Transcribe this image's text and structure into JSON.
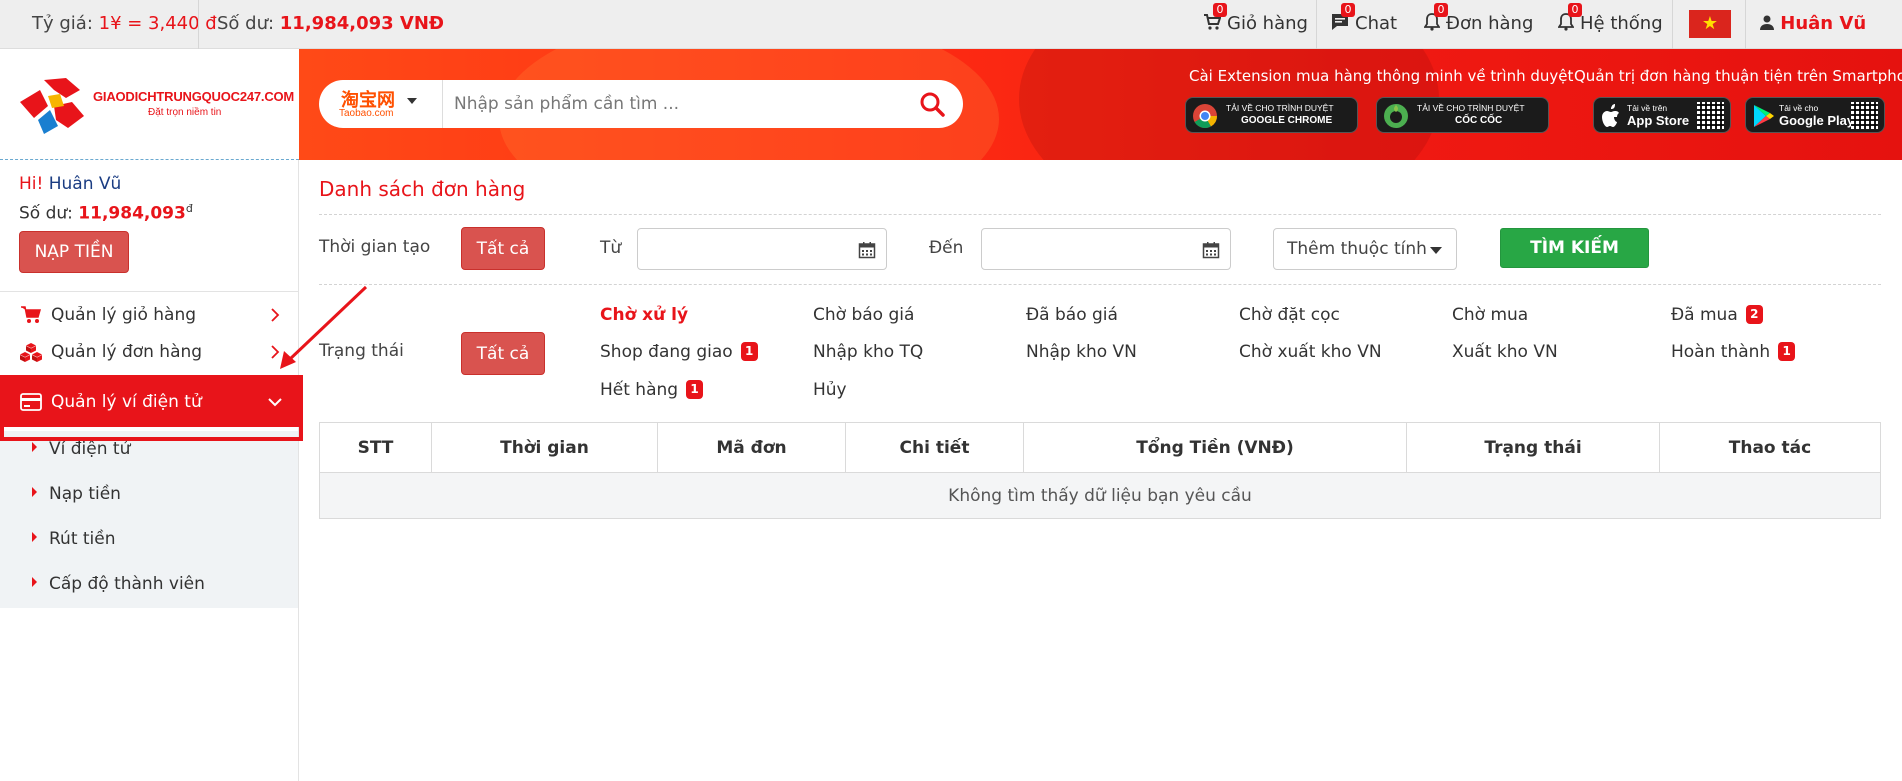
{
  "topbar": {
    "rate_label": "Tỷ giá: ",
    "rate_value": "1¥ = 3,440 đ",
    "balance_label": "Số dư: ",
    "balance_value": "11,984,093 VNĐ",
    "nav": [
      {
        "label": "Giỏ hàng",
        "badge": "0",
        "icon": "cart-icon"
      },
      {
        "label": "Chat",
        "badge": "0",
        "icon": "chat-icon"
      },
      {
        "label": "Đơn hàng",
        "badge": "0",
        "icon": "bell-icon"
      },
      {
        "label": "Hệ thống",
        "badge": "0",
        "icon": "bell-icon"
      }
    ],
    "flag_star": "★",
    "user_name": "Huân Vũ"
  },
  "header": {
    "logo_text": "GIAODICHTRUNGQUOC247.COM",
    "logo_sub": "Đặt trọn niềm tin",
    "source_name_cn": "淘宝网",
    "source_name": "Taobao.com",
    "search_placeholder": "Nhập sản phẩm cần tìm ...",
    "ext_caption": "Cài Extension mua hàng thông minh về trình duyệt",
    "app_caption": "Quản trị đơn hàng thuận tiện trên Smartphone",
    "chrome_line1": "TẢI VỀ CHO TRÌNH DUYỆT",
    "chrome_line2": "GOOGLE CHROME",
    "coccoc_line1": "TẢI VỀ CHO TRÌNH DUYỆT",
    "coccoc_line2": "CỐC CỐC",
    "appstore_line1": "Tải về trên",
    "appstore_line2": "App Store",
    "gplay_line1": "Tải về cho",
    "gplay_line2": "Google Play"
  },
  "sidebar": {
    "hi_label": "Hi! ",
    "user_name": "Huân Vũ",
    "balance_label": "Số dư: ",
    "balance_value": "11,984,093",
    "balance_unit": "đ",
    "topup_button": "NẠP TIỀN",
    "menu": [
      {
        "label": "Quản lý giỏ hàng",
        "icon": "cart-icon"
      },
      {
        "label": "Quản lý đơn hàng",
        "icon": "boxes-icon"
      },
      {
        "label": "Quản lý ví điện tử",
        "icon": "credit-card-icon",
        "active": true
      }
    ],
    "submenu": [
      {
        "label": "Ví điện tử"
      },
      {
        "label": "Nạp tiền"
      },
      {
        "label": "Rút tiền"
      },
      {
        "label": "Cấp độ thành viên"
      }
    ]
  },
  "main": {
    "title": "Danh sách đơn hàng",
    "filters": {
      "created_label": "Thời gian tạo",
      "all_button": "Tất cả",
      "from_label": "Từ",
      "to_label": "Đến",
      "more_attr": "Thêm thuộc tính",
      "search_button": "TÌM KIẾM"
    },
    "status": {
      "label": "Trạng thái",
      "all_button": "Tất cả",
      "items": [
        {
          "label": "Chờ xử lý",
          "badge": "",
          "active": true
        },
        {
          "label": "Chờ báo giá",
          "badge": ""
        },
        {
          "label": "Đã báo giá",
          "badge": ""
        },
        {
          "label": "Chờ đặt cọc",
          "badge": ""
        },
        {
          "label": "Chờ mua",
          "badge": ""
        },
        {
          "label": "Đã mua",
          "badge": "2"
        },
        {
          "label": "Shop đang giao",
          "badge": "1"
        },
        {
          "label": "Nhập kho TQ",
          "badge": ""
        },
        {
          "label": "Nhập kho VN",
          "badge": ""
        },
        {
          "label": "Chờ xuất kho VN",
          "badge": ""
        },
        {
          "label": "Xuất kho VN",
          "badge": ""
        },
        {
          "label": "Hoàn thành",
          "badge": "1"
        },
        {
          "label": "Hết hàng",
          "badge": "1"
        },
        {
          "label": "Hủy",
          "badge": ""
        }
      ]
    },
    "table": {
      "headers": [
        "STT",
        "Thời gian",
        "Mã đơn",
        "Chi tiết",
        "Tổng Tiền (VNĐ)",
        "Trạng thái",
        "Thao tác"
      ],
      "empty_message": "Không tìm thấy dữ liệu bạn yêu cầu"
    }
  },
  "colors": {
    "accent": "#e8141a",
    "button_red": "#d9534f",
    "button_green": "#28a745"
  }
}
